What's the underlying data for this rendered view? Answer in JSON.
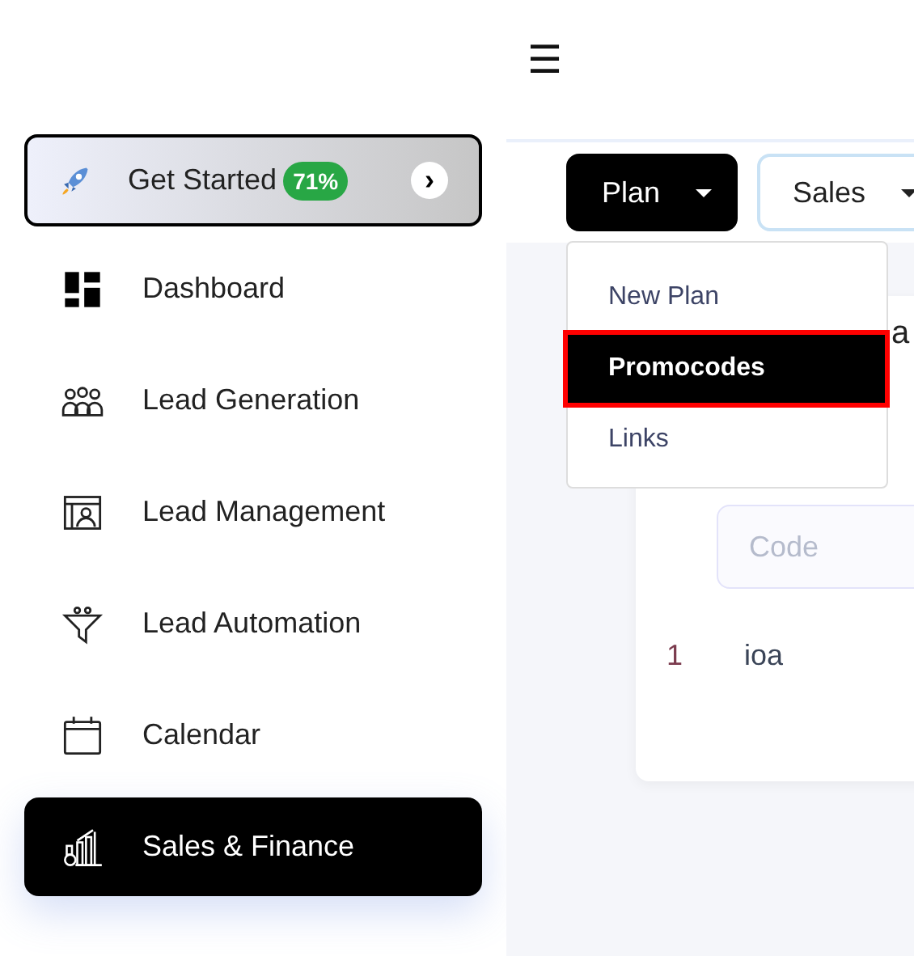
{
  "header": {
    "menu_icon": "☰"
  },
  "get_started": {
    "label": "Get Started",
    "badge": "71%",
    "arrow": "›"
  },
  "sidebar": {
    "items": [
      {
        "label": "Dashboard",
        "selected": false
      },
      {
        "label": "Lead Generation",
        "selected": false
      },
      {
        "label": "Lead Management",
        "selected": false
      },
      {
        "label": "Lead Automation",
        "selected": false
      },
      {
        "label": "Calendar",
        "selected": false
      },
      {
        "label": "Sales & Finance",
        "selected": true
      }
    ]
  },
  "toolbar": {
    "buttons": [
      {
        "label": "Plan",
        "selected": true
      },
      {
        "label": "Sales",
        "selected": false
      }
    ]
  },
  "dropdown": {
    "items": [
      {
        "label": "New Plan",
        "selected": false
      },
      {
        "label": "Promocodes",
        "selected": true
      },
      {
        "label": "Links",
        "selected": false
      }
    ]
  },
  "card": {
    "title": "a",
    "code_field": {
      "placeholder": "Code"
    },
    "rows": [
      {
        "index": "1",
        "code": "ioa"
      }
    ]
  }
}
